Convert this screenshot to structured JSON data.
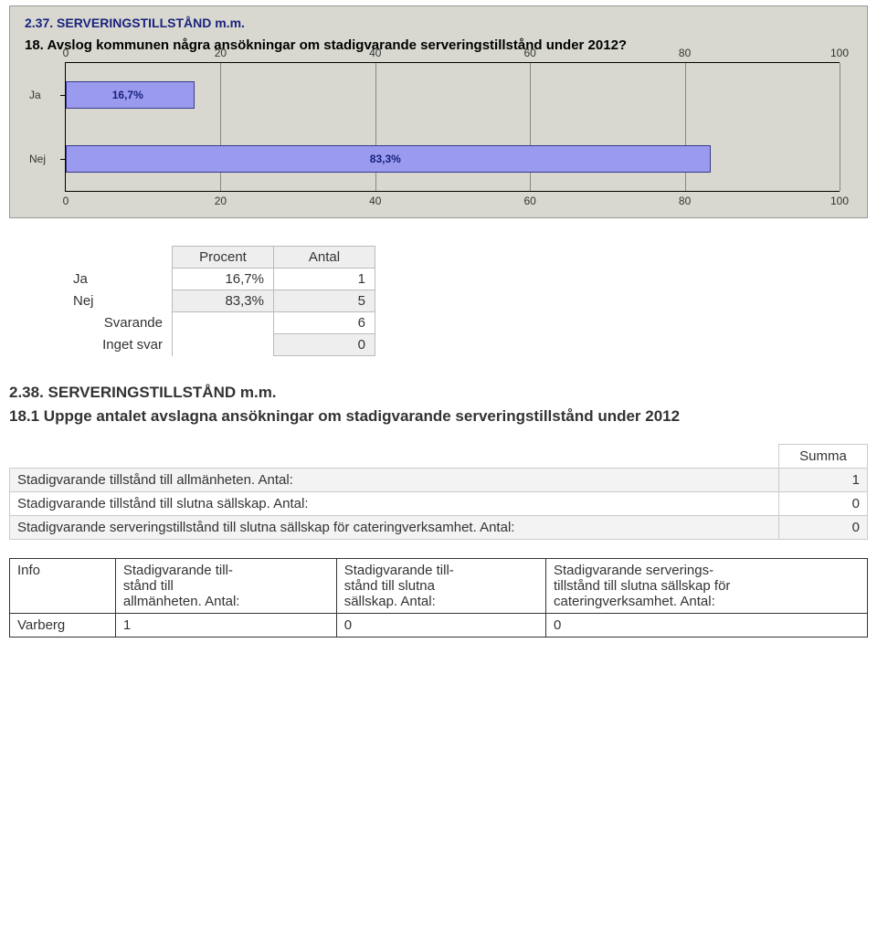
{
  "chart_data": {
    "type": "bar",
    "orientation": "horizontal",
    "title": "2.37. SERVERINGSTILLSTÅND m.m.",
    "subtitle": "18. Avslog kommunen några ansökningar om stadigvarande serveringstillstånd under 2012?",
    "categories": [
      "Ja",
      "Nej"
    ],
    "values": [
      16.7,
      83.3
    ],
    "value_labels": [
      "16,7%",
      "83,3%"
    ],
    "xlabel": "",
    "ylabel": "",
    "xlim": [
      0,
      100
    ],
    "top_ticks": [
      0,
      20,
      40,
      60,
      80,
      100
    ],
    "bottom_ticks": [
      0,
      20,
      40,
      60,
      80,
      100
    ]
  },
  "pa": {
    "head_procent": "Procent",
    "head_antal": "Antal",
    "rows": [
      {
        "label": "Ja",
        "procent": "16,7%",
        "antal": "1"
      },
      {
        "label": "Nej",
        "procent": "83,3%",
        "antal": "5"
      }
    ],
    "svarande_label": "Svarande",
    "svarande_val": "6",
    "inget_label": "Inget svar",
    "inget_val": "0"
  },
  "section": {
    "heading": "2.38. SERVERINGSTILLSTÅND m.m.",
    "question": "18.1 Uppge antalet avslagna ansökningar om stadigvarande serveringstillstånd under 2012"
  },
  "summa": {
    "head": "Summa",
    "rows": [
      {
        "label": "Stadigvarande tillstånd till allmänheten. Antal:",
        "val": "1"
      },
      {
        "label": "Stadigvarande tillstånd till slutna sällskap. Antal:",
        "val": "0"
      },
      {
        "label": "Stadigvarande serveringstillstånd till slutna sällskap för cateringverksamhet. Antal:",
        "val": "0"
      }
    ]
  },
  "info": {
    "corner": "Info",
    "cols": [
      "Stadigvarande till-\nstånd till\nallmänheten. Antal:",
      "Stadigvarande till-\nstånd till slutna\nsällskap. Antal:",
      "Stadigvarande serverings-\ntillstånd till slutna sällskap för\ncateringverksamhet. Antal:"
    ],
    "row_label": "Varberg",
    "row_vals": [
      "1",
      "0",
      "0"
    ]
  }
}
